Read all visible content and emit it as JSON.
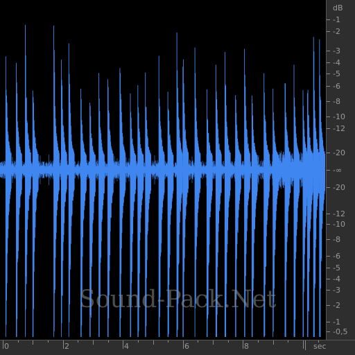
{
  "db_scale": {
    "unit": "dB",
    "labels_top": [
      "-1",
      "-2",
      "-3",
      "-4",
      "-5",
      "-6",
      "-8",
      "-10",
      "-12",
      "-20"
    ],
    "center_label": "-∞",
    "labels_bottom": [
      "-20",
      "-12",
      "-10",
      "-8",
      "-6",
      "-5",
      "-4",
      "-3",
      "-2",
      "-1",
      "-0,5"
    ]
  },
  "time_ruler": {
    "labels": [
      "0",
      "2",
      "4",
      "6",
      "8"
    ],
    "unit": "sec"
  },
  "watermark": "Sound-Pack.Net",
  "colors": {
    "waveform": "#3f86f0",
    "background": "#000000",
    "panel": "#2e2e2e",
    "label": "#9a9a9a"
  },
  "waveform": {
    "duration_sec": 10.8,
    "transients_sec": [
      0.1,
      0.45,
      0.75,
      1.0,
      1.7,
      1.95,
      2.2,
      2.6,
      2.9,
      3.2,
      3.5,
      3.9,
      4.25,
      4.5,
      4.75,
      5.2,
      5.5,
      5.8,
      6.0,
      6.4,
      6.8,
      7.1,
      7.4,
      7.75,
      8.05,
      8.3,
      8.7,
      9.0,
      9.4,
      9.7,
      10.0,
      10.15,
      10.35,
      10.55
    ]
  }
}
